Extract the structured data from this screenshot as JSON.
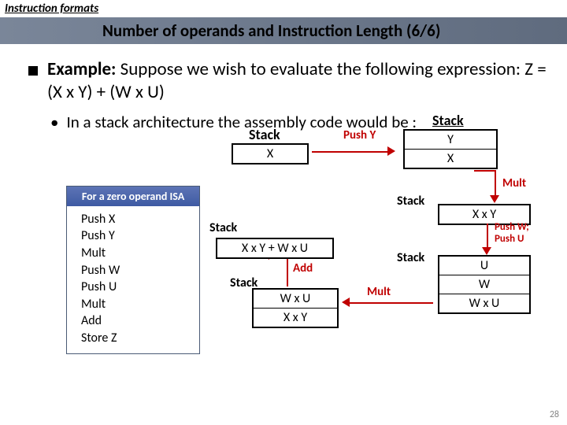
{
  "topic": "Instruction formats",
  "title": "Number of operands and Instruction Length (6/6)",
  "main_bullet_strong": "Example:",
  "main_bullet_rest": " Suppose we wish to evaluate the following expression: Z = (X x Y) + (W x U)",
  "sub_bullet": "In a stack architecture the assembly code would be :",
  "isa_header": "For a zero operand ISA",
  "isa_lines": [
    "Push X",
    "Push Y",
    "Mult",
    "Push W",
    "Push U",
    "Mult",
    "Add",
    "Store Z"
  ],
  "stacks": {
    "s1": {
      "label": "Stack",
      "cells": [
        "X"
      ]
    },
    "s2": {
      "label": "Stack",
      "cells": [
        "Y",
        "X"
      ]
    },
    "s3": {
      "label": "Stack",
      "cells": [
        "X x Y"
      ]
    },
    "s4": {
      "label": "Stack",
      "cells": [
        "U",
        "W",
        "W x U"
      ]
    },
    "s5": {
      "label": "Stack",
      "cells": [
        "W x U",
        "X x Y"
      ]
    },
    "s6": {
      "label": "Stack",
      "cells": [
        "X x Y + W x U"
      ]
    }
  },
  "ops": {
    "pushY": "Push Y",
    "mult1": "Mult",
    "pushWU": "Push W;\nPush U",
    "mult2": "Mult",
    "add": "Add"
  },
  "page": "28"
}
